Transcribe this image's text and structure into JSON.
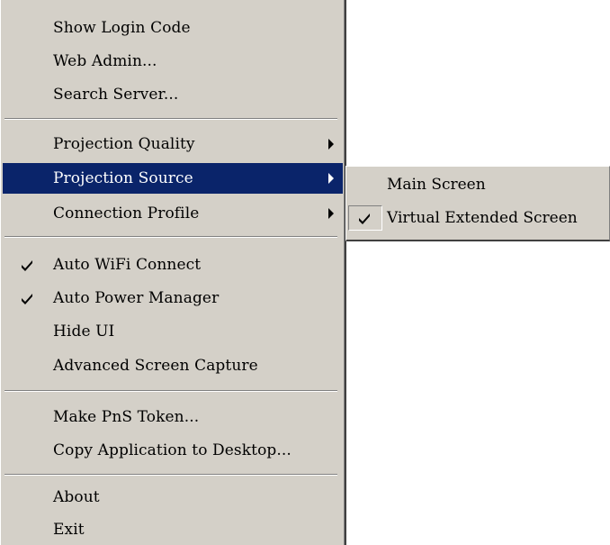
{
  "menu": {
    "items": [
      {
        "label": "Show Login Code"
      },
      {
        "label": "Web Admin..."
      },
      {
        "label": "Search Server..."
      },
      {
        "label": "Projection Quality"
      },
      {
        "label": "Projection Source"
      },
      {
        "label": "Connection Profile"
      },
      {
        "label": "Auto WiFi Connect",
        "checked": true
      },
      {
        "label": "Auto Power Manager",
        "checked": true
      },
      {
        "label": "Hide UI"
      },
      {
        "label": "Advanced Screen Capture"
      },
      {
        "label": "Make PnS Token..."
      },
      {
        "label": "Copy Application to Desktop..."
      },
      {
        "label": "About"
      },
      {
        "label": "Exit"
      }
    ],
    "highlighted_item": "Projection Source"
  },
  "submenu": {
    "parent": "Projection Source",
    "items": [
      {
        "label": "Main Screen",
        "checked": false
      },
      {
        "label": "Virtual Extended Screen",
        "checked": true
      }
    ]
  },
  "colors": {
    "menu_background": "#d4d0c8",
    "highlight_background": "#0a246a",
    "highlight_text": "#ffffff",
    "text": "#000000"
  },
  "icons": {
    "check": "check-icon",
    "submenu_arrow": "submenu-arrow-icon"
  }
}
